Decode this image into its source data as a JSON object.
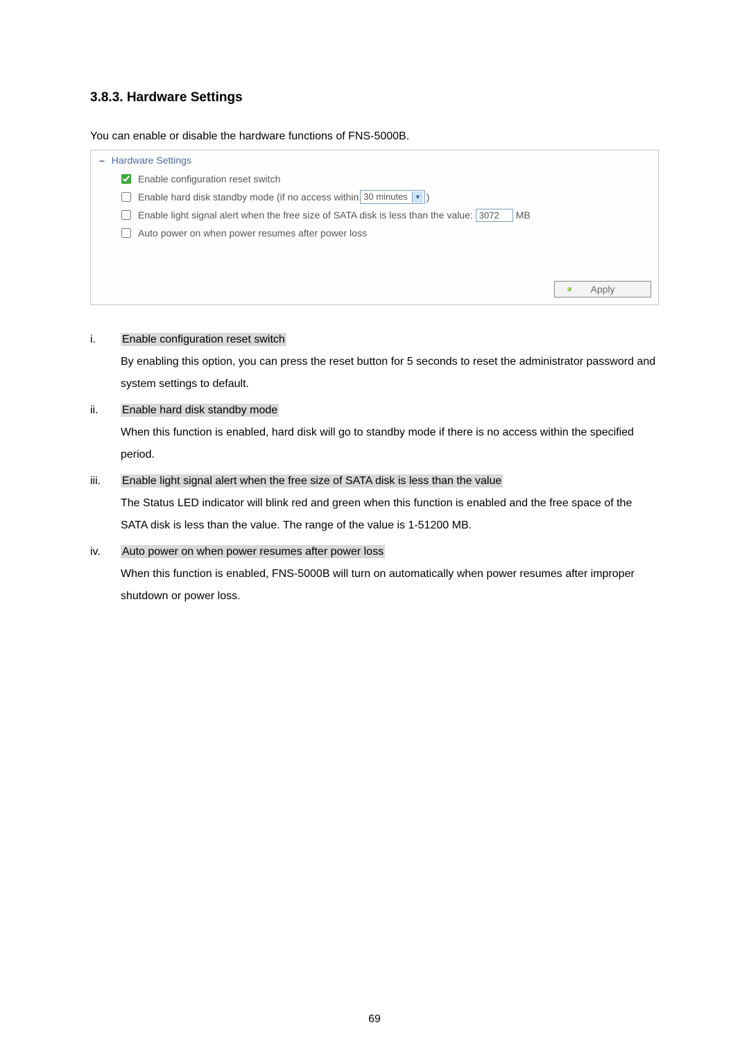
{
  "heading": "3.8.3.  Hardware Settings",
  "intro": "You can enable or disable the hardware functions of FNS-5000B.",
  "panel": {
    "title": "Hardware Settings",
    "options": {
      "opt1_label": "Enable configuration reset switch",
      "opt2_prefix": "Enable hard disk standby mode (if no access within ",
      "opt2_select_value": "30 minutes",
      "opt2_suffix": " )",
      "opt3_prefix": "Enable light signal alert when the free size of SATA disk is less than the value: ",
      "opt3_input_value": "3072",
      "opt3_suffix": " MB",
      "opt4_label": "Auto power on when power resumes after power loss"
    },
    "apply_label": "Apply"
  },
  "list": [
    {
      "marker": "i.",
      "title": "Enable configuration reset switch",
      "body": "By enabling this option, you can press the reset button for 5 seconds to reset the administrator password and system settings to default."
    },
    {
      "marker": "ii.",
      "title": "Enable hard disk standby mode",
      "body": "When this function is enabled, hard disk will go to standby mode if there is no access within the specified period."
    },
    {
      "marker": "iii.",
      "title": "Enable light signal alert when the free size of SATA disk is less than the value",
      "body": "The Status LED indicator will blink red and green when this function is enabled and the free space of the SATA disk is less than the value.  The range of the value is 1-51200 MB."
    },
    {
      "marker": "iv.",
      "title": "Auto power on when power resumes after power loss",
      "body": "When this function is enabled, FNS-5000B will turn on automatically when power resumes after improper shutdown or power loss."
    }
  ],
  "page_number": "69"
}
